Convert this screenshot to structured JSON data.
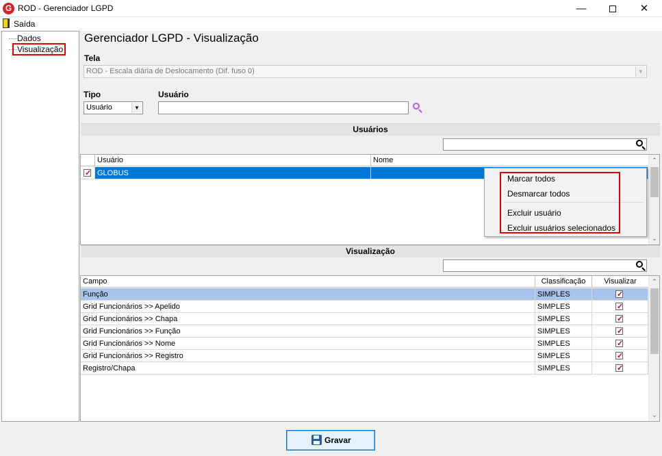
{
  "window": {
    "title": "ROD - Gerenciador LGPD",
    "logo_letter": "G",
    "minimize_glyph": "—",
    "close_glyph": "✕"
  },
  "menu": {
    "exit_label": "Saída"
  },
  "tree": {
    "items": [
      {
        "label": "Dados"
      },
      {
        "label": "Visualização"
      }
    ]
  },
  "header": {
    "title": "Gerenciador LGPD - Visualização"
  },
  "form": {
    "tela_label": "Tela",
    "tela_value": "ROD - Escala diária de Deslocamento (Dif. fuso 0)",
    "tipo_label": "Tipo",
    "tipo_value": "Usuário",
    "usuario_label": "Usuário",
    "usuario_value": ""
  },
  "users_section": {
    "title": "Usuários",
    "search_value": "",
    "columns": [
      "Usuário",
      "Nome"
    ],
    "rows": [
      {
        "usuario": "GLOBUS",
        "nome": "",
        "checked": true
      }
    ]
  },
  "context_menu": {
    "items": [
      "Marcar todos",
      "Desmarcar todos",
      "Excluir usuário",
      "Excluir usuários selecionados"
    ]
  },
  "view_section": {
    "title": "Visualização",
    "search_value": "",
    "columns": [
      "Campo",
      "Classificação",
      "Visualizar"
    ],
    "rows": [
      {
        "campo": "Função",
        "classificacao": "SIMPLES",
        "visualizar": true
      },
      {
        "campo": "Grid Funcionários >> Apelido",
        "classificacao": "SIMPLES",
        "visualizar": true
      },
      {
        "campo": "Grid Funcionários >> Chapa",
        "classificacao": "SIMPLES",
        "visualizar": true
      },
      {
        "campo": "Grid Funcionários >> Função",
        "classificacao": "SIMPLES",
        "visualizar": true
      },
      {
        "campo": "Grid Funcionários >> Nome",
        "classificacao": "SIMPLES",
        "visualizar": true
      },
      {
        "campo": "Grid Funcionários >> Registro",
        "classificacao": "SIMPLES",
        "visualizar": true
      },
      {
        "campo": "Registro/Chapa",
        "classificacao": "SIMPLES",
        "visualizar": true
      }
    ]
  },
  "footer": {
    "save_label": "Gravar"
  },
  "colors": {
    "highlight_red": "#e00000",
    "selection_blue": "#0078d7",
    "selection_light": "#a9c4ec",
    "check_red": "#d0021b"
  }
}
